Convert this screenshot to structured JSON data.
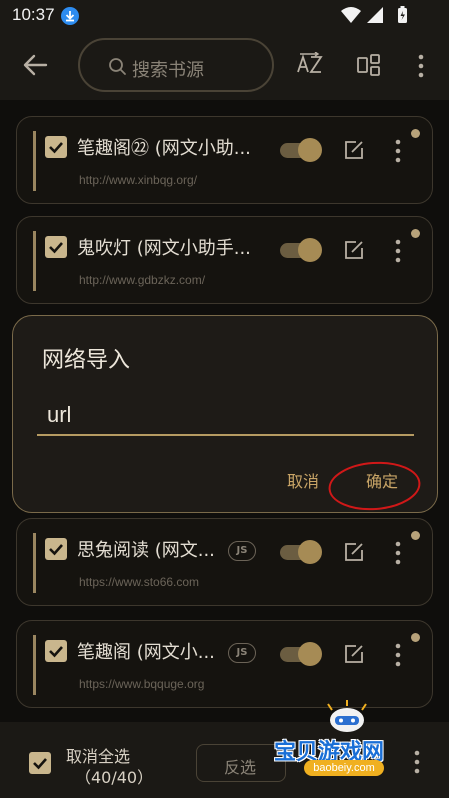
{
  "status_bar": {
    "time": "10:37"
  },
  "toolbar": {
    "search_placeholder": "搜索书源",
    "sort_icon": "sort-az-icon",
    "group_icon": "group-icon",
    "more_icon": "more-vertical-icon"
  },
  "sources": [
    {
      "name": "笔趣阁㉒ (网文小助...",
      "url": "http://www.xinbqg.org/",
      "js": false,
      "checked": true,
      "enabled": true
    },
    {
      "name": "鬼吹灯 (网文小助手...",
      "url": "http://www.gdbzkz.com/",
      "js": false,
      "checked": true,
      "enabled": true
    },
    {
      "name": "思兔阅读 (网文...",
      "url": "https://www.sto66.com",
      "js": true,
      "js_label": "JS",
      "checked": true,
      "enabled": true
    },
    {
      "name": "笔趣阁 (网文小...",
      "url": "https://www.bqquge.org",
      "js": true,
      "js_label": "JS",
      "checked": true,
      "enabled": true
    }
  ],
  "dialog": {
    "title": "网络导入",
    "input_value": "url",
    "cancel_label": "取消",
    "ok_label": "确定",
    "highlight_color": "#d01818"
  },
  "bottom_bar": {
    "select_label": "取消全选",
    "count": "（40/40）",
    "invert_label": "反选"
  },
  "watermark": {
    "text": "宝贝游戏网",
    "url": "baobeiy.com"
  },
  "colors": {
    "accent": "#c9a567",
    "background": "#0f0e0c"
  }
}
